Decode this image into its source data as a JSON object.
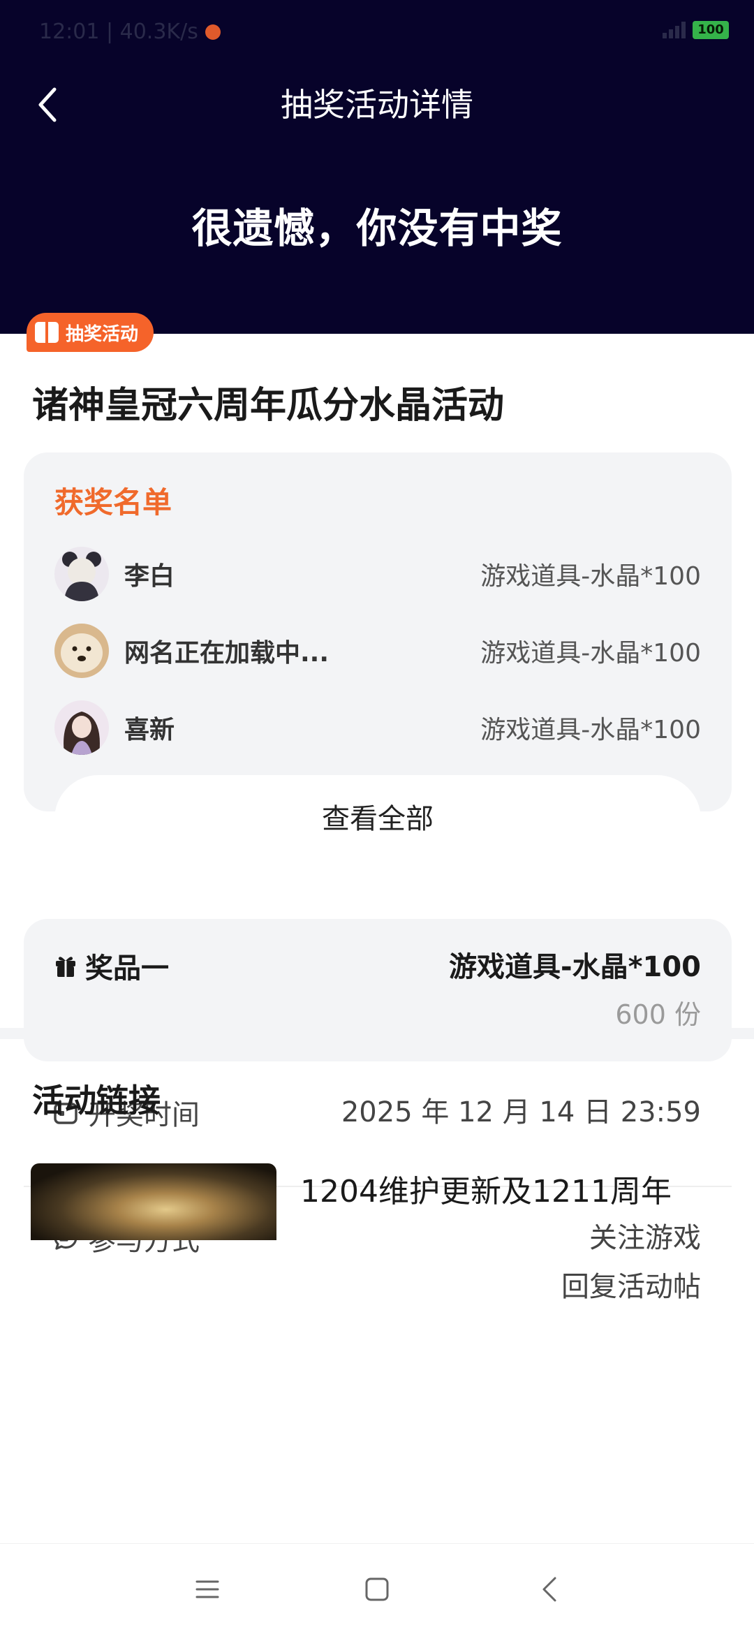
{
  "status_bar": {
    "time_speed": "12:01 | 40.3K/s",
    "battery": "100"
  },
  "header": {
    "title": "抽奖活动详情",
    "result": "很遗憾，你没有中奖"
  },
  "activity": {
    "tag": "抽奖活动",
    "title": "诸神皇冠六周年瓜分水晶活动"
  },
  "winners": {
    "title": "获奖名单",
    "items": [
      {
        "name": "李白",
        "prize": "游戏道具-水晶*100"
      },
      {
        "name": "网名正在加载中...",
        "prize": "游戏道具-水晶*100"
      },
      {
        "name": "喜新",
        "prize": "游戏道具-水晶*100"
      }
    ],
    "view_all": "查看全部"
  },
  "prize": {
    "label": "奖品一",
    "name": "游戏道具-水晶*100",
    "count": "600 份"
  },
  "draw_time": {
    "label": "开奖时间",
    "value": "2025 年 12 月 14 日 23:59"
  },
  "participation": {
    "label": "参与方式",
    "values": [
      "关注游戏",
      "回复活动帖"
    ]
  },
  "links": {
    "title": "活动链接",
    "item_title": "1204维护更新及1211周年"
  },
  "colors": {
    "header_bg": "#07032a",
    "accent": "#f5632a",
    "card_bg": "#f3f4f6"
  }
}
